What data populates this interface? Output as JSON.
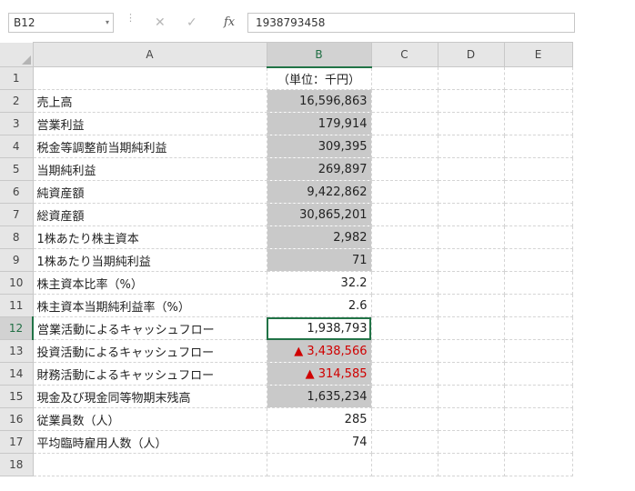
{
  "formula_bar": {
    "name_box": "B12",
    "name_box_arrow": "▾",
    "separator": "⋮",
    "cancel_label": "✕",
    "enter_label": "✓",
    "fx_label": "fx",
    "formula": "1938793458"
  },
  "columns": [
    "A",
    "B",
    "C",
    "D",
    "E"
  ],
  "rows": [
    {
      "n": "1",
      "a": "",
      "b": "（単位：千円）",
      "b_shaded": false,
      "b_red": false,
      "b_align": "cen"
    },
    {
      "n": "2",
      "a": "売上高",
      "b": "16,596,863",
      "b_shaded": true,
      "b_red": false,
      "b_align": "num"
    },
    {
      "n": "3",
      "a": "営業利益",
      "b": "179,914",
      "b_shaded": true,
      "b_red": false,
      "b_align": "num"
    },
    {
      "n": "4",
      "a": "税金等調整前当期純利益",
      "b": "309,395",
      "b_shaded": true,
      "b_red": false,
      "b_align": "num"
    },
    {
      "n": "5",
      "a": "当期純利益",
      "b": "269,897",
      "b_shaded": true,
      "b_red": false,
      "b_align": "num"
    },
    {
      "n": "6",
      "a": "純資産額",
      "b": "9,422,862",
      "b_shaded": true,
      "b_red": false,
      "b_align": "num"
    },
    {
      "n": "7",
      "a": "総資産額",
      "b": "30,865,201",
      "b_shaded": true,
      "b_red": false,
      "b_align": "num"
    },
    {
      "n": "8",
      "a": "1株あたり株主資本",
      "b": "2,982",
      "b_shaded": true,
      "b_red": false,
      "b_align": "num"
    },
    {
      "n": "9",
      "a": "1株あたり当期純利益",
      "b": "71",
      "b_shaded": true,
      "b_red": false,
      "b_align": "num"
    },
    {
      "n": "10",
      "a": "株主資本比率（%）",
      "b": "32.2",
      "b_shaded": false,
      "b_red": false,
      "b_align": "num"
    },
    {
      "n": "11",
      "a": "株主資本当期純利益率（%）",
      "b": "2.6",
      "b_shaded": false,
      "b_red": false,
      "b_align": "num"
    },
    {
      "n": "12",
      "a": "営業活動によるキャッシュフロー",
      "b": "1,938,793",
      "b_shaded": false,
      "b_red": false,
      "b_align": "num"
    },
    {
      "n": "13",
      "a": "投資活動によるキャッシュフロー",
      "b": "▲ 3,438,566",
      "b_shaded": true,
      "b_red": true,
      "b_align": "num"
    },
    {
      "n": "14",
      "a": "財務活動によるキャッシュフロー",
      "b": "▲ 314,585",
      "b_shaded": true,
      "b_red": true,
      "b_align": "num"
    },
    {
      "n": "15",
      "a": "現金及び現金同等物期末残高",
      "b": "1,635,234",
      "b_shaded": true,
      "b_red": false,
      "b_align": "num"
    },
    {
      "n": "16",
      "a": "従業員数（人）",
      "b": "285",
      "b_shaded": false,
      "b_red": false,
      "b_align": "num"
    },
    {
      "n": "17",
      "a": "平均臨時雇用人数（人）",
      "b": "74",
      "b_shaded": false,
      "b_red": false,
      "b_align": "num"
    },
    {
      "n": "18",
      "a": "",
      "b": "",
      "b_shaded": false,
      "b_red": false,
      "b_align": "num"
    }
  ],
  "active_row": "12",
  "selected_column": "B",
  "colors": {
    "accent": "#217346",
    "negative": "#d00000",
    "shade": "#c9c9c9"
  }
}
